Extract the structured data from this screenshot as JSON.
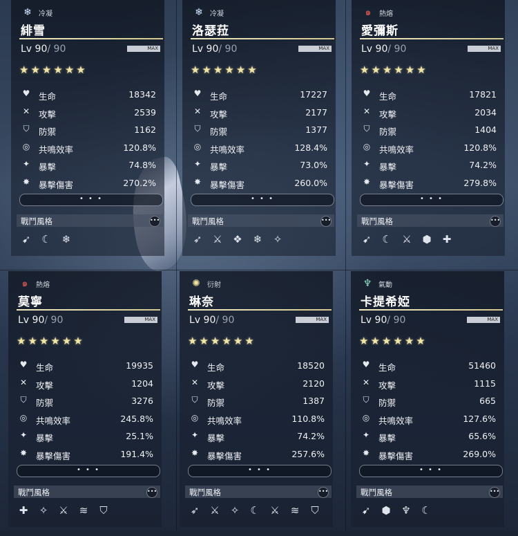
{
  "stat_names": [
    "生命",
    "攻擊",
    "防禦",
    "共鳴效率",
    "暴擊",
    "暴擊傷害"
  ],
  "stat_icons": [
    "heart-crack-icon",
    "crossed-swords-icon",
    "shield-icon",
    "resonance-icon",
    "crit-star-icon",
    "crit-burst-icon"
  ],
  "stat_glyphs": [
    "♥",
    "✕",
    "⛉",
    "◎",
    "✦",
    "✸"
  ],
  "section_label": "戰鬥風格",
  "expand_label": "• • •",
  "more_label": "•••",
  "lv_prefix": "Lv",
  "max_badge": "MAX",
  "characters": [
    {
      "element": "冷凝",
      "element_icon": "snowflake-icon",
      "element_glyph": "❄",
      "element_color": "#cfe3ff",
      "name": "緋雪",
      "level": "90",
      "max_level": "/ 90",
      "stars": 6,
      "stats": [
        "18342",
        "2539",
        "1162",
        "120.8%",
        "74.8%",
        "270.2%"
      ],
      "style_icons": [
        {
          "icon": "scythe-slash-icon",
          "glyph": "➹"
        },
        {
          "icon": "swirl-moon-icon",
          "glyph": "☾"
        },
        {
          "icon": "snowflake-hex-icon",
          "glyph": "❄"
        }
      ]
    },
    {
      "element": "冷凝",
      "element_icon": "snowflake-icon",
      "element_glyph": "❄",
      "element_color": "#cfe3ff",
      "name": "洛瑟菈",
      "level": "90",
      "max_level": "/ 90",
      "stars": 6,
      "stats": [
        "17227",
        "2177",
        "1377",
        "128.4%",
        "73.0%",
        "260.0%"
      ],
      "style_icons": [
        {
          "icon": "double-slash-icon",
          "glyph": "➶"
        },
        {
          "icon": "sword-icon",
          "glyph": "⚔"
        },
        {
          "icon": "drop-icon",
          "glyph": "❖"
        },
        {
          "icon": "snowflake-hex-icon",
          "glyph": "❄"
        },
        {
          "icon": "sparkle-drop-icon",
          "glyph": "✧"
        }
      ]
    },
    {
      "element": "熱熔",
      "element_icon": "fire-swirl-icon",
      "element_glyph": "๑",
      "element_color": "#e05a4e",
      "name": "愛彌斯",
      "level": "90",
      "max_level": "/ 90",
      "stars": 6,
      "stats": [
        "17821",
        "2034",
        "1404",
        "120.8%",
        "74.2%",
        "279.8%"
      ],
      "style_icons": [
        {
          "icon": "scythe-slash-icon",
          "glyph": "➹"
        },
        {
          "icon": "swirl-moon-icon",
          "glyph": "☾"
        },
        {
          "icon": "crossed-blades-icon",
          "glyph": "⚔"
        },
        {
          "icon": "hex-rune-icon",
          "glyph": "⬢"
        },
        {
          "icon": "sparkle-plus-icon",
          "glyph": "✚"
        }
      ]
    },
    {
      "element": "熱熔",
      "element_icon": "fire-swirl-icon",
      "element_glyph": "๑",
      "element_color": "#e05a4e",
      "name": "莫寧",
      "level": "90",
      "max_level": "/ 90",
      "stars": 6,
      "stats": [
        "19935",
        "1204",
        "3276",
        "245.8%",
        "25.1%",
        "191.4%"
      ],
      "style_icons": [
        {
          "icon": "healing-cross-icon",
          "glyph": "✚"
        },
        {
          "icon": "sparkle-plus-icon",
          "glyph": "✧"
        },
        {
          "icon": "crossed-blades-icon",
          "glyph": "⚔"
        },
        {
          "icon": "wave-icon",
          "glyph": "≋"
        },
        {
          "icon": "shield-heal-icon",
          "glyph": "⛉"
        }
      ]
    },
    {
      "element": "衍射",
      "element_icon": "sun-icon",
      "element_glyph": "✺",
      "element_color": "#f4e3a0",
      "name": "琳奈",
      "level": "90",
      "max_level": "/ 90",
      "stars": 6,
      "stats": [
        "18520",
        "2120",
        "1387",
        "110.8%",
        "74.2%",
        "257.6%"
      ],
      "style_icons": [
        {
          "icon": "double-slash-icon",
          "glyph": "➶"
        },
        {
          "icon": "sword-icon",
          "glyph": "⚔"
        },
        {
          "icon": "sparkle-plus-icon",
          "glyph": "✧"
        },
        {
          "icon": "swirl-moon-icon",
          "glyph": "☾"
        },
        {
          "icon": "crossed-blades-icon",
          "glyph": "⚔"
        },
        {
          "icon": "wave-icon",
          "glyph": "≋"
        },
        {
          "icon": "shield-heal-icon",
          "glyph": "⛉"
        }
      ]
    },
    {
      "element": "氣動",
      "element_icon": "wind-crest-icon",
      "element_glyph": "♆",
      "element_color": "#8fe0c6",
      "name": "卡提希婭",
      "level": "90",
      "max_level": "/ 90",
      "stars": 6,
      "stats": [
        "51460",
        "1115",
        "665",
        "127.6%",
        "65.6%",
        "269.0%"
      ],
      "style_icons": [
        {
          "icon": "scythe-slash-icon",
          "glyph": "➹"
        },
        {
          "icon": "hex-rune-icon",
          "glyph": "⬢"
        },
        {
          "icon": "wind-crest-icon",
          "glyph": "♆"
        },
        {
          "icon": "swirl-moon-icon",
          "glyph": "☾"
        }
      ]
    }
  ]
}
